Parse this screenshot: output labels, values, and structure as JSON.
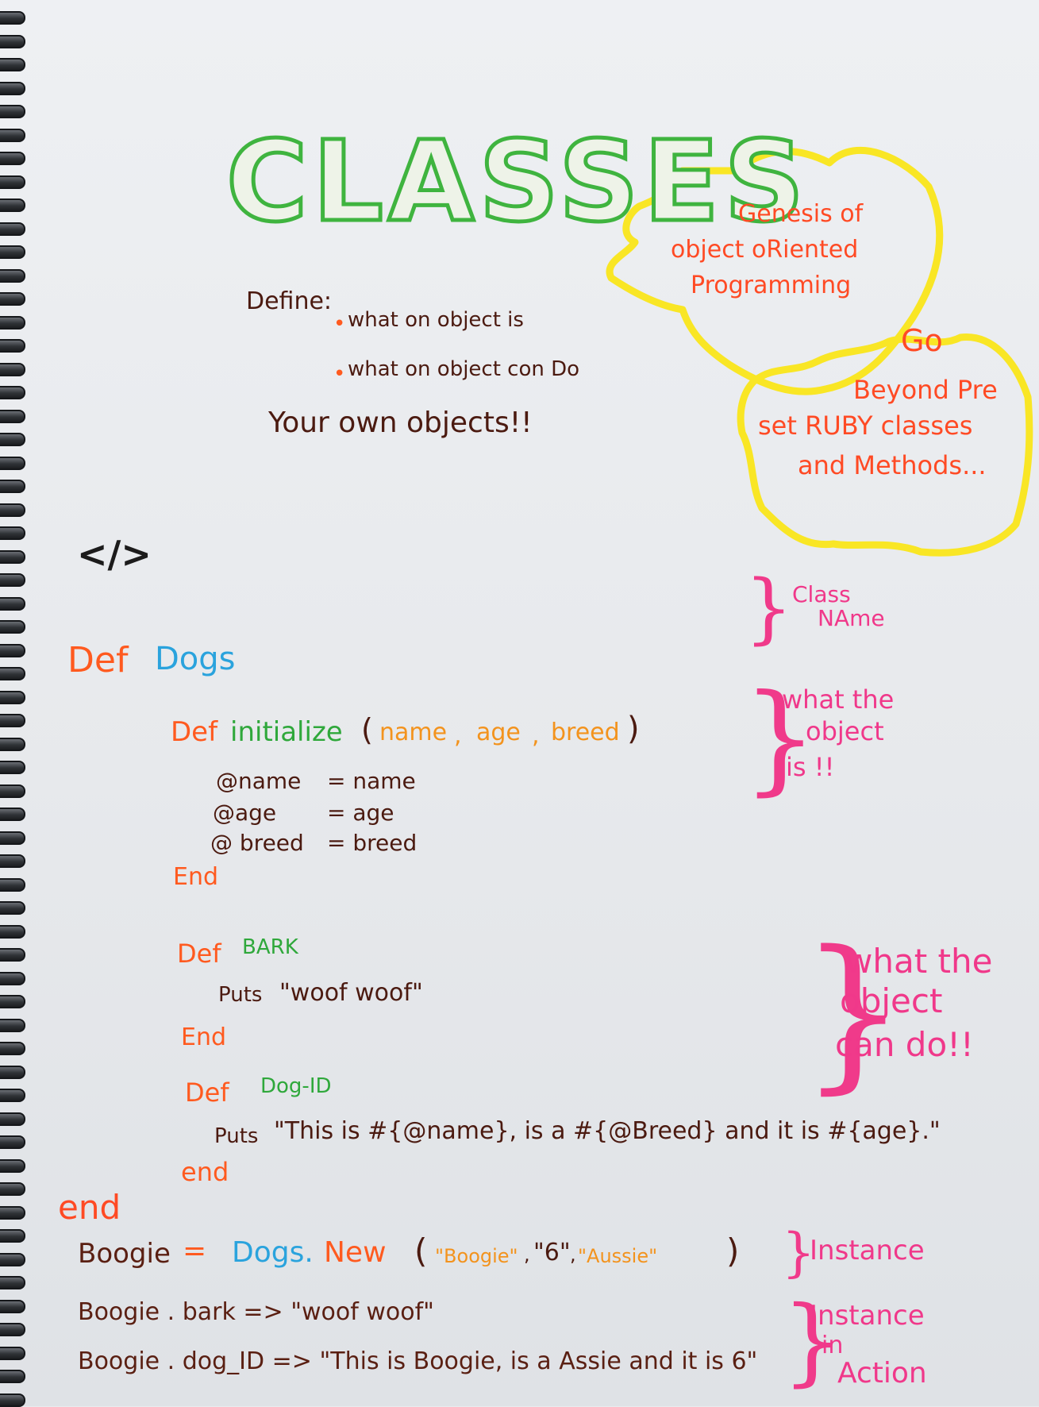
{
  "title": "CLASSES",
  "colors": {
    "title_outline": "#3fb43f",
    "highlight": "#f9e625",
    "keyword": "#ff5a1f",
    "annotation": "#f0388a",
    "class_name": "#2aa3dd",
    "text": "#4b1a10"
  },
  "define": {
    "label": "Define:",
    "point1": "what on object is",
    "point2": "what on object con Do",
    "closing": "Your own objects!!"
  },
  "callout": {
    "genesis_line1": "Genesis of",
    "genesis_line2": "object oRiented",
    "genesis_line3": "Programming",
    "beyond_line1": "Go",
    "beyond_line2": "Beyond Pre",
    "beyond_line3": "set RUBY classes",
    "beyond_line4": "and Methods..."
  },
  "code_icon": "</>",
  "code": {
    "class_kw": "Def",
    "class_name": "Dogs",
    "init_kw": "Def",
    "init_name": "initialize",
    "init_params_open": "(",
    "param_name": "name",
    "param_age": "age",
    "param_breed": "breed",
    "init_params_close": ")",
    "assign_name_var": "@name",
    "assign_name_val": "= name",
    "assign_age_var": "@age",
    "assign_age_val": "= age",
    "assign_breed_var": "@ breed",
    "assign_breed_val": "= breed",
    "init_end": "End",
    "bark_kw": "Def",
    "bark_name": "BARK",
    "bark_body_kw": "Puts",
    "bark_body_str": "\"woof woof\"",
    "bark_end": "End",
    "dogid_kw": "Def",
    "dogid_name": "Dog-ID",
    "dogid_body_kw": "Puts",
    "dogid_body_str": "\"This is #{@name}, is a #{@Breed} and it is #{age}.\"",
    "dogid_end": "end",
    "class_end": "end"
  },
  "instance": {
    "var": "Boogie",
    "eq": "=",
    "cls": "Dogs.",
    "new_kw": "New",
    "args_open": "(",
    "arg1": "\"Boogie\"",
    "arg2": "\"6\"",
    "arg3": "\"Aussie\"",
    "args_close": ")"
  },
  "calls": {
    "call1": "Boogie . bark => \"woof woof\"",
    "call2": "Boogie . dog_ID => \"This is Boogie, is a Assie and it is 6\""
  },
  "annotations": {
    "class_name_line1": "Class",
    "class_name_line2": "NAme",
    "is_line1": "what the",
    "is_line2": "object",
    "is_line3": "is !!",
    "do_line1": "what the",
    "do_line2": "object",
    "do_line3": "can do!!",
    "instance": "Instance",
    "action_line1": "Instance",
    "action_line2": "in",
    "action_line3": "Action"
  }
}
